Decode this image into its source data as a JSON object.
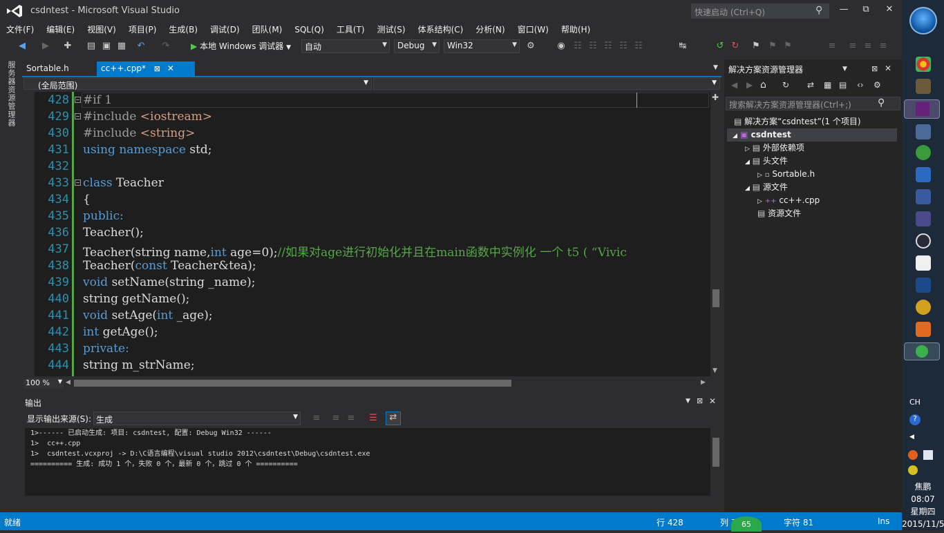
{
  "window": {
    "title": "csdntest - Microsoft Visual Studio",
    "quick_launch": "快速启动 (Ctrl+Q)"
  },
  "menu": [
    "文件(F)",
    "编辑(E)",
    "视图(V)",
    "项目(P)",
    "生成(B)",
    "调试(D)",
    "团队(M)",
    "SQL(Q)",
    "工具(T)",
    "测试(S)",
    "体系结构(C)",
    "分析(N)",
    "窗口(W)",
    "帮助(H)"
  ],
  "toolbar": {
    "run_label": "本地 Windows 调试器",
    "solution_config_mode": "自动",
    "config": "Debug",
    "platform": "Win32"
  },
  "left_strip": {
    "server_explorer": "服务器资源管理器"
  },
  "tabs": [
    {
      "label": "Sortable.h"
    },
    {
      "label": "cc++.cpp*"
    }
  ],
  "scope": {
    "left": "(全局范围)"
  },
  "editor": {
    "lines": [
      {
        "num": "428"
      },
      {
        "num": "429"
      },
      {
        "num": "430"
      },
      {
        "num": "431"
      },
      {
        "num": "432"
      },
      {
        "num": "433"
      },
      {
        "num": "434"
      },
      {
        "num": "435"
      },
      {
        "num": "436"
      },
      {
        "num": "437"
      },
      {
        "num": "438"
      },
      {
        "num": "439"
      },
      {
        "num": "440"
      },
      {
        "num": "441"
      },
      {
        "num": "442"
      },
      {
        "num": "443"
      },
      {
        "num": "444"
      }
    ],
    "code": {
      "l428": "#if 1",
      "l429a": "#include ",
      "l429b": "<iostream>",
      "l430a": "#include ",
      "l430b": "<string>",
      "l431a": "using namespace",
      "l431b": " std;",
      "l433a": "class",
      "l433b": " Teacher",
      "l434": "{",
      "l435": "public:",
      "l436": "Teacher();",
      "l437a": "Teacher(string name,",
      "l437b": "int",
      "l437c": " age=0);",
      "l437d": "//如果对age进行初始化并且在main函数中实例化 一个 t5 ( “Vivic",
      "l438a": "Teacher(",
      "l438b": "const",
      "l438c": " Teacher&tea);",
      "l439a": "void",
      "l439b": " setName(string _name);",
      "l440": "string getName();",
      "l441a": "void",
      "l441b": " setAge(",
      "l441c": "int",
      "l441d": " _age);",
      "l442a": "int",
      "l442b": " getAge();",
      "l443": "private:",
      "l444": "string m_strName;"
    },
    "zoom": "100 %"
  },
  "output": {
    "title": "输出",
    "source_label": "显示输出来源(S):",
    "source_value": "生成",
    "lines": [
      "1>------ 已启动生成: 项目: csdntest, 配置: Debug Win32 ------",
      "1>  cc++.cpp",
      "1>  csdntest.vcxproj -> D:\\C语言编程\\visual studio 2012\\csdntest\\Debug\\csdntest.exe",
      "========== 生成: 成功 1 个，失败 0 个，最新 0 个，跳过 0 个 =========="
    ]
  },
  "solution_explorer": {
    "title": "解决方案资源管理器",
    "search_placeholder": "搜索解决方案资源管理器(Ctrl+;)",
    "solution": "解决方案“csdntest”(1 个项目)",
    "project": "csdntest",
    "nodes": {
      "external": "外部依赖项",
      "headers": "头文件",
      "sortable": "Sortable.h",
      "sources": "源文件",
      "cpp": "cc++.cpp",
      "resources": "资源文件"
    }
  },
  "status": {
    "ready": "就绪",
    "line": "行 428",
    "col": "列 7",
    "char": "字符 81",
    "mode": "Ins",
    "badge": "65"
  },
  "taskbar": {
    "ime": "CH",
    "user": "焦鹏 08:07",
    "weekday": "星期四",
    "date": "2015/11/5"
  }
}
